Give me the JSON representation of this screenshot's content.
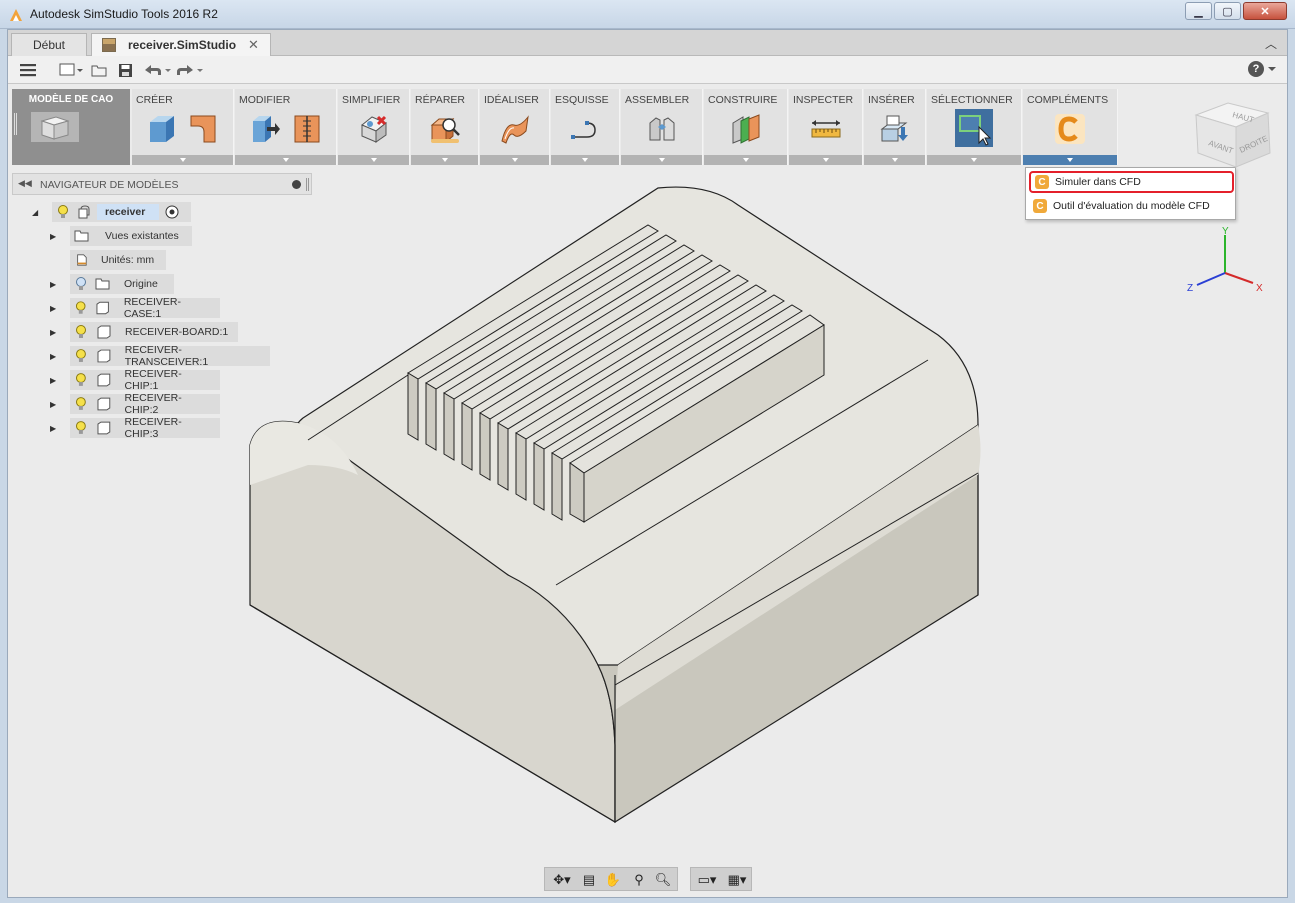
{
  "window": {
    "title": "Autodesk SimStudio Tools 2016 R2",
    "minimize_label": "▁",
    "maximize_label": "▢",
    "close_label": "✕"
  },
  "tabs": {
    "home_label": "Début",
    "active_label": "receiver.SimStudio",
    "close_glyph": "✕",
    "chevron": "︿"
  },
  "quick_access": {
    "menu_icon": "hamburger-icon",
    "new_icon": "new-file-icon",
    "open_icon": "open-folder-icon",
    "save_icon": "save-icon",
    "undo_icon": "undo-icon",
    "redo_icon": "redo-icon",
    "help_label": "?"
  },
  "ribbon": {
    "workspace_label": "MODÈLE DE CAO",
    "groups": [
      {
        "label": "CRÉER",
        "icons": [
          "box-icon",
          "sketch-shape-icon"
        ]
      },
      {
        "label": "MODIFIER",
        "icons": [
          "push-pull-icon",
          "split-body-icon"
        ]
      },
      {
        "label": "SIMPLIFIER",
        "icons": [
          "remove-features-icon"
        ]
      },
      {
        "label": "RÉPARER",
        "icons": [
          "repair-icon"
        ]
      },
      {
        "label": "IDÉALISER",
        "icons": [
          "idealize-icon"
        ]
      },
      {
        "label": "ESQUISSE",
        "icons": [
          "sketch-curve-icon"
        ]
      },
      {
        "label": "ASSEMBLER",
        "icons": [
          "joint-icon"
        ]
      },
      {
        "label": "CONSTRUIRE",
        "icons": [
          "construct-plane-icon"
        ]
      },
      {
        "label": "INSPECTER",
        "icons": [
          "measure-icon"
        ]
      },
      {
        "label": "INSÉRER",
        "icons": [
          "insert-icon"
        ]
      },
      {
        "label": "SÉLECTIONNER",
        "icons": [
          "select-window-icon"
        ]
      },
      {
        "label": "COMPLÉMENTS",
        "icons": [
          "cfd-addin-icon"
        ]
      }
    ]
  },
  "addins_menu": {
    "items": [
      {
        "label": "Simuler dans CFD",
        "icon": "cfd-icon",
        "highlighted": true
      },
      {
        "label": "Outil d'évaluation du modèle CFD",
        "icon": "cfd-icon",
        "highlighted": false
      }
    ]
  },
  "viewcube": {
    "top": "HAUT",
    "front": "AVANT",
    "right": "DROITE"
  },
  "triad": {
    "x": "X",
    "y": "Y",
    "z": "Z",
    "colors": {
      "x": "#d42a2a",
      "y": "#2bb52b",
      "z": "#2a3fd4"
    }
  },
  "browser": {
    "title": "NAVIGATEUR DE MODÈLES",
    "root": {
      "label": "receiver"
    },
    "nodes": [
      {
        "label": "Vues existantes"
      },
      {
        "label": "Unités: mm"
      },
      {
        "label": "Origine"
      },
      {
        "label": "RECEIVER-CASE:1"
      },
      {
        "label": "RECEIVER-BOARD:1"
      },
      {
        "label": "RECEIVER-TRANSCEIVER:1"
      },
      {
        "label": "RECEIVER-CHIP:1"
      },
      {
        "label": "RECEIVER-CHIP:2"
      },
      {
        "label": "RECEIVER-CHIP:3"
      }
    ]
  },
  "navbar": {
    "icons": [
      "orbit-icon",
      "look-at-icon",
      "pan-icon",
      "zoom-icon",
      "zoom-window-icon",
      "display-mode-icon",
      "grid-icon"
    ]
  },
  "colors": {
    "selection_blue": "#4d7fb0",
    "highlight_red": "#e4202b",
    "cfd_orange": "#f0a93a"
  }
}
